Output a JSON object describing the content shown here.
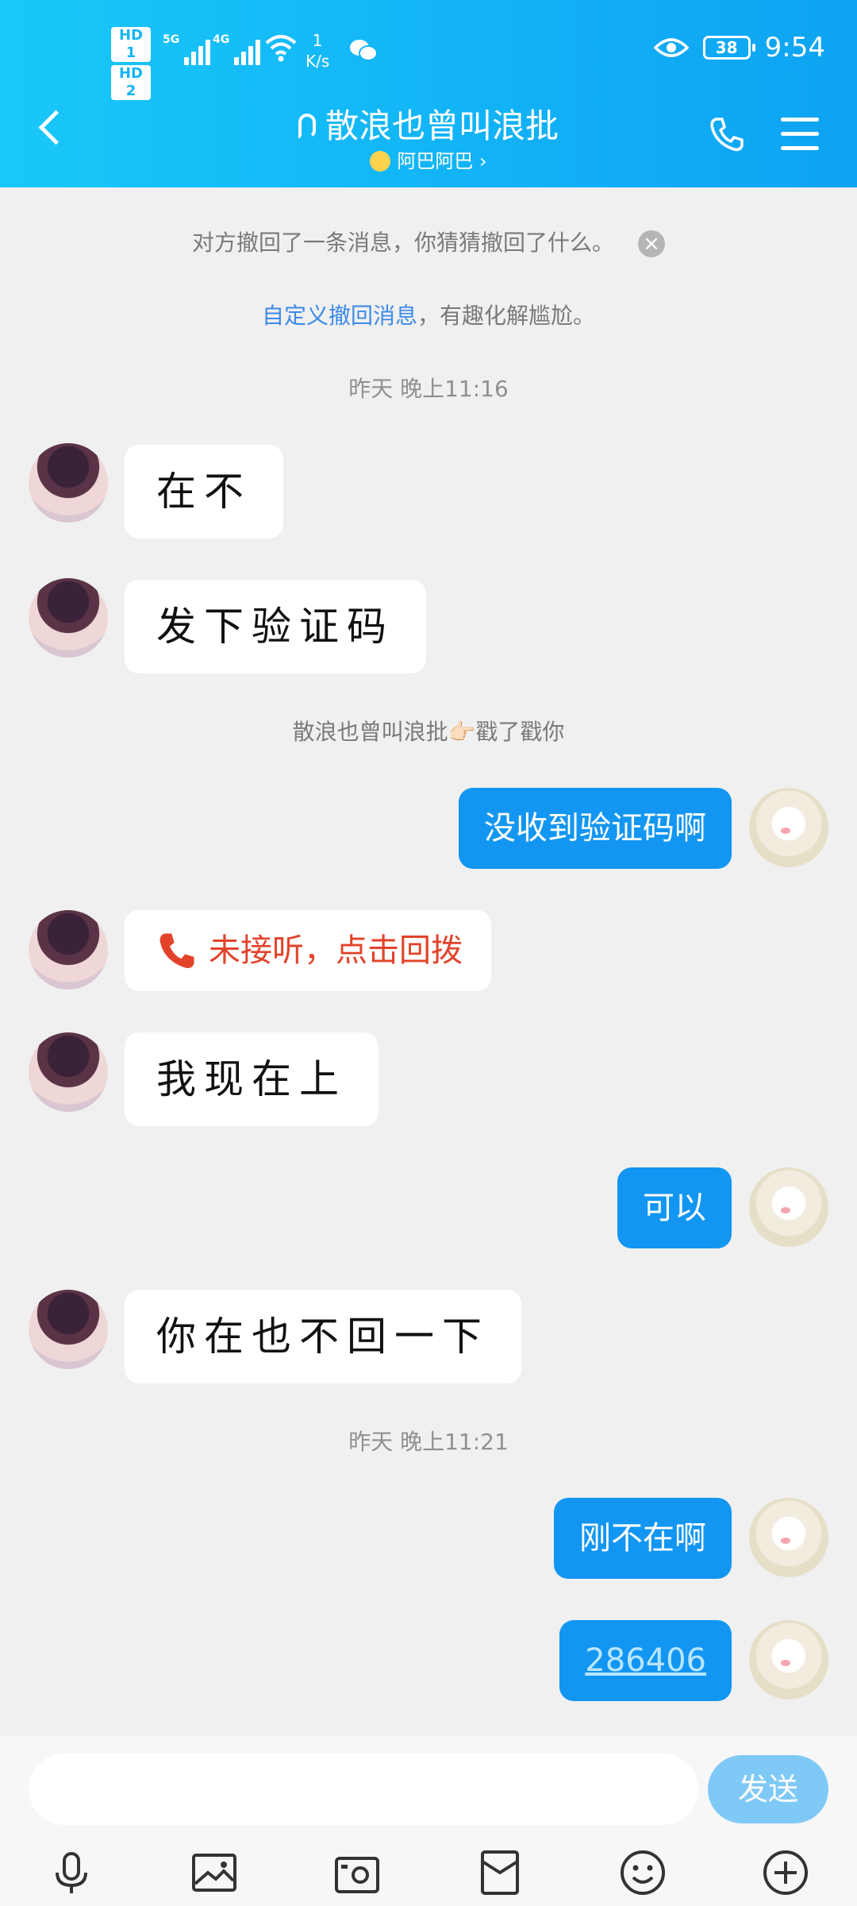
{
  "status_bar": {
    "hd1": "HD 1",
    "hd2": "HD 2",
    "sig1": "5G",
    "sig2": "4G",
    "net_speed_value": "1",
    "net_speed_unit": "K/s",
    "battery": "38",
    "time": "9:54"
  },
  "header": {
    "title": "散浪也曾叫浪批",
    "subtitle": "阿巴阿巴 ›"
  },
  "chat": {
    "recall_notice": "对方撤回了一条消息，你猜猜撤回了什么。",
    "custom_recall_link": "自定义撤回消息",
    "custom_recall_suffix": "，有趣化解尴尬。",
    "ts1": "昨天 晚上11:16",
    "msg1": "在不",
    "msg2": "发下验证码",
    "poke_notice": "散浪也曾叫浪批👉🏻戳了戳你",
    "msg3": "没收到验证码啊",
    "missed_call": "未接听，点击回拨",
    "msg4": "我现在上",
    "msg5": "可以",
    "msg6": "你在也不回一下",
    "ts2": "昨天 晚上11:21",
    "msg7": "刚不在啊",
    "msg8": "286406"
  },
  "input_bar": {
    "placeholder": "",
    "send_label": "发送"
  },
  "toolbar_icons": [
    "microphone-icon",
    "image-icon",
    "camera-icon",
    "red-packet-icon",
    "emoji-icon",
    "plus-icon"
  ],
  "colors": {
    "header": "#12b3f6",
    "outgoing_bubble": "#1296f2",
    "missed_call": "#e2432a",
    "send_button": "#7fc9f7"
  }
}
